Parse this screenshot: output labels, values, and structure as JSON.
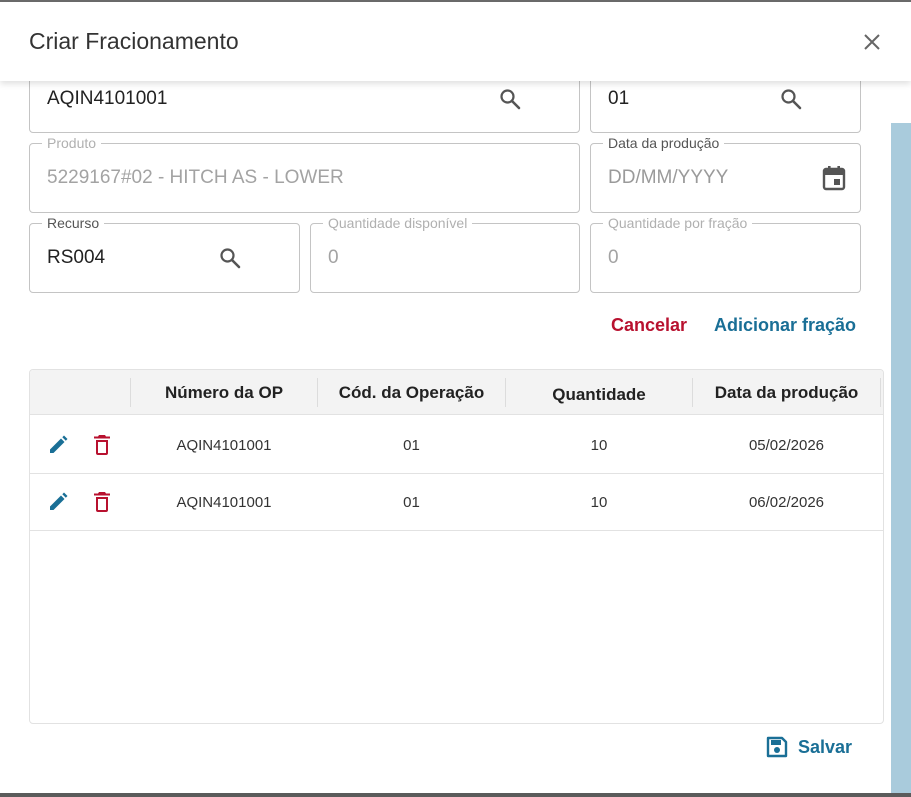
{
  "dialog": {
    "title": "Criar Fracionamento"
  },
  "fields": {
    "op_number": {
      "value": "AQIN4101001"
    },
    "operation": {
      "value": "01"
    },
    "produto": {
      "label": "Produto",
      "value": "5229167#02 - HITCH AS - LOWER"
    },
    "data_producao": {
      "label": "Data da produção",
      "placeholder": "DD/MM/YYYY"
    },
    "recurso": {
      "label": "Recurso",
      "value": "RS004"
    },
    "qtd_disponivel": {
      "label": "Quantidade disponível",
      "value": "0"
    },
    "qtd_fracao": {
      "label": "Quantidade por fração",
      "value": "0"
    }
  },
  "actions": {
    "cancel": "Cancelar",
    "add": "Adicionar fração",
    "save": "Salvar"
  },
  "table": {
    "headers": [
      "Número da OP",
      "Cód. da Operação",
      "Quantidade",
      "Data da produção"
    ],
    "rows": [
      [
        "AQIN4101001",
        "01",
        "10",
        "05/02/2026"
      ],
      [
        "AQIN4101001",
        "01",
        "10",
        "06/02/2026"
      ]
    ]
  },
  "colors": {
    "primary": "#1a6f96",
    "danger": "#b8112f",
    "scroll_thumb": "#a9cbdc"
  },
  "icons": [
    "close-icon",
    "search-icon",
    "calendar-icon",
    "edit-icon",
    "delete-icon",
    "save-icon"
  ]
}
